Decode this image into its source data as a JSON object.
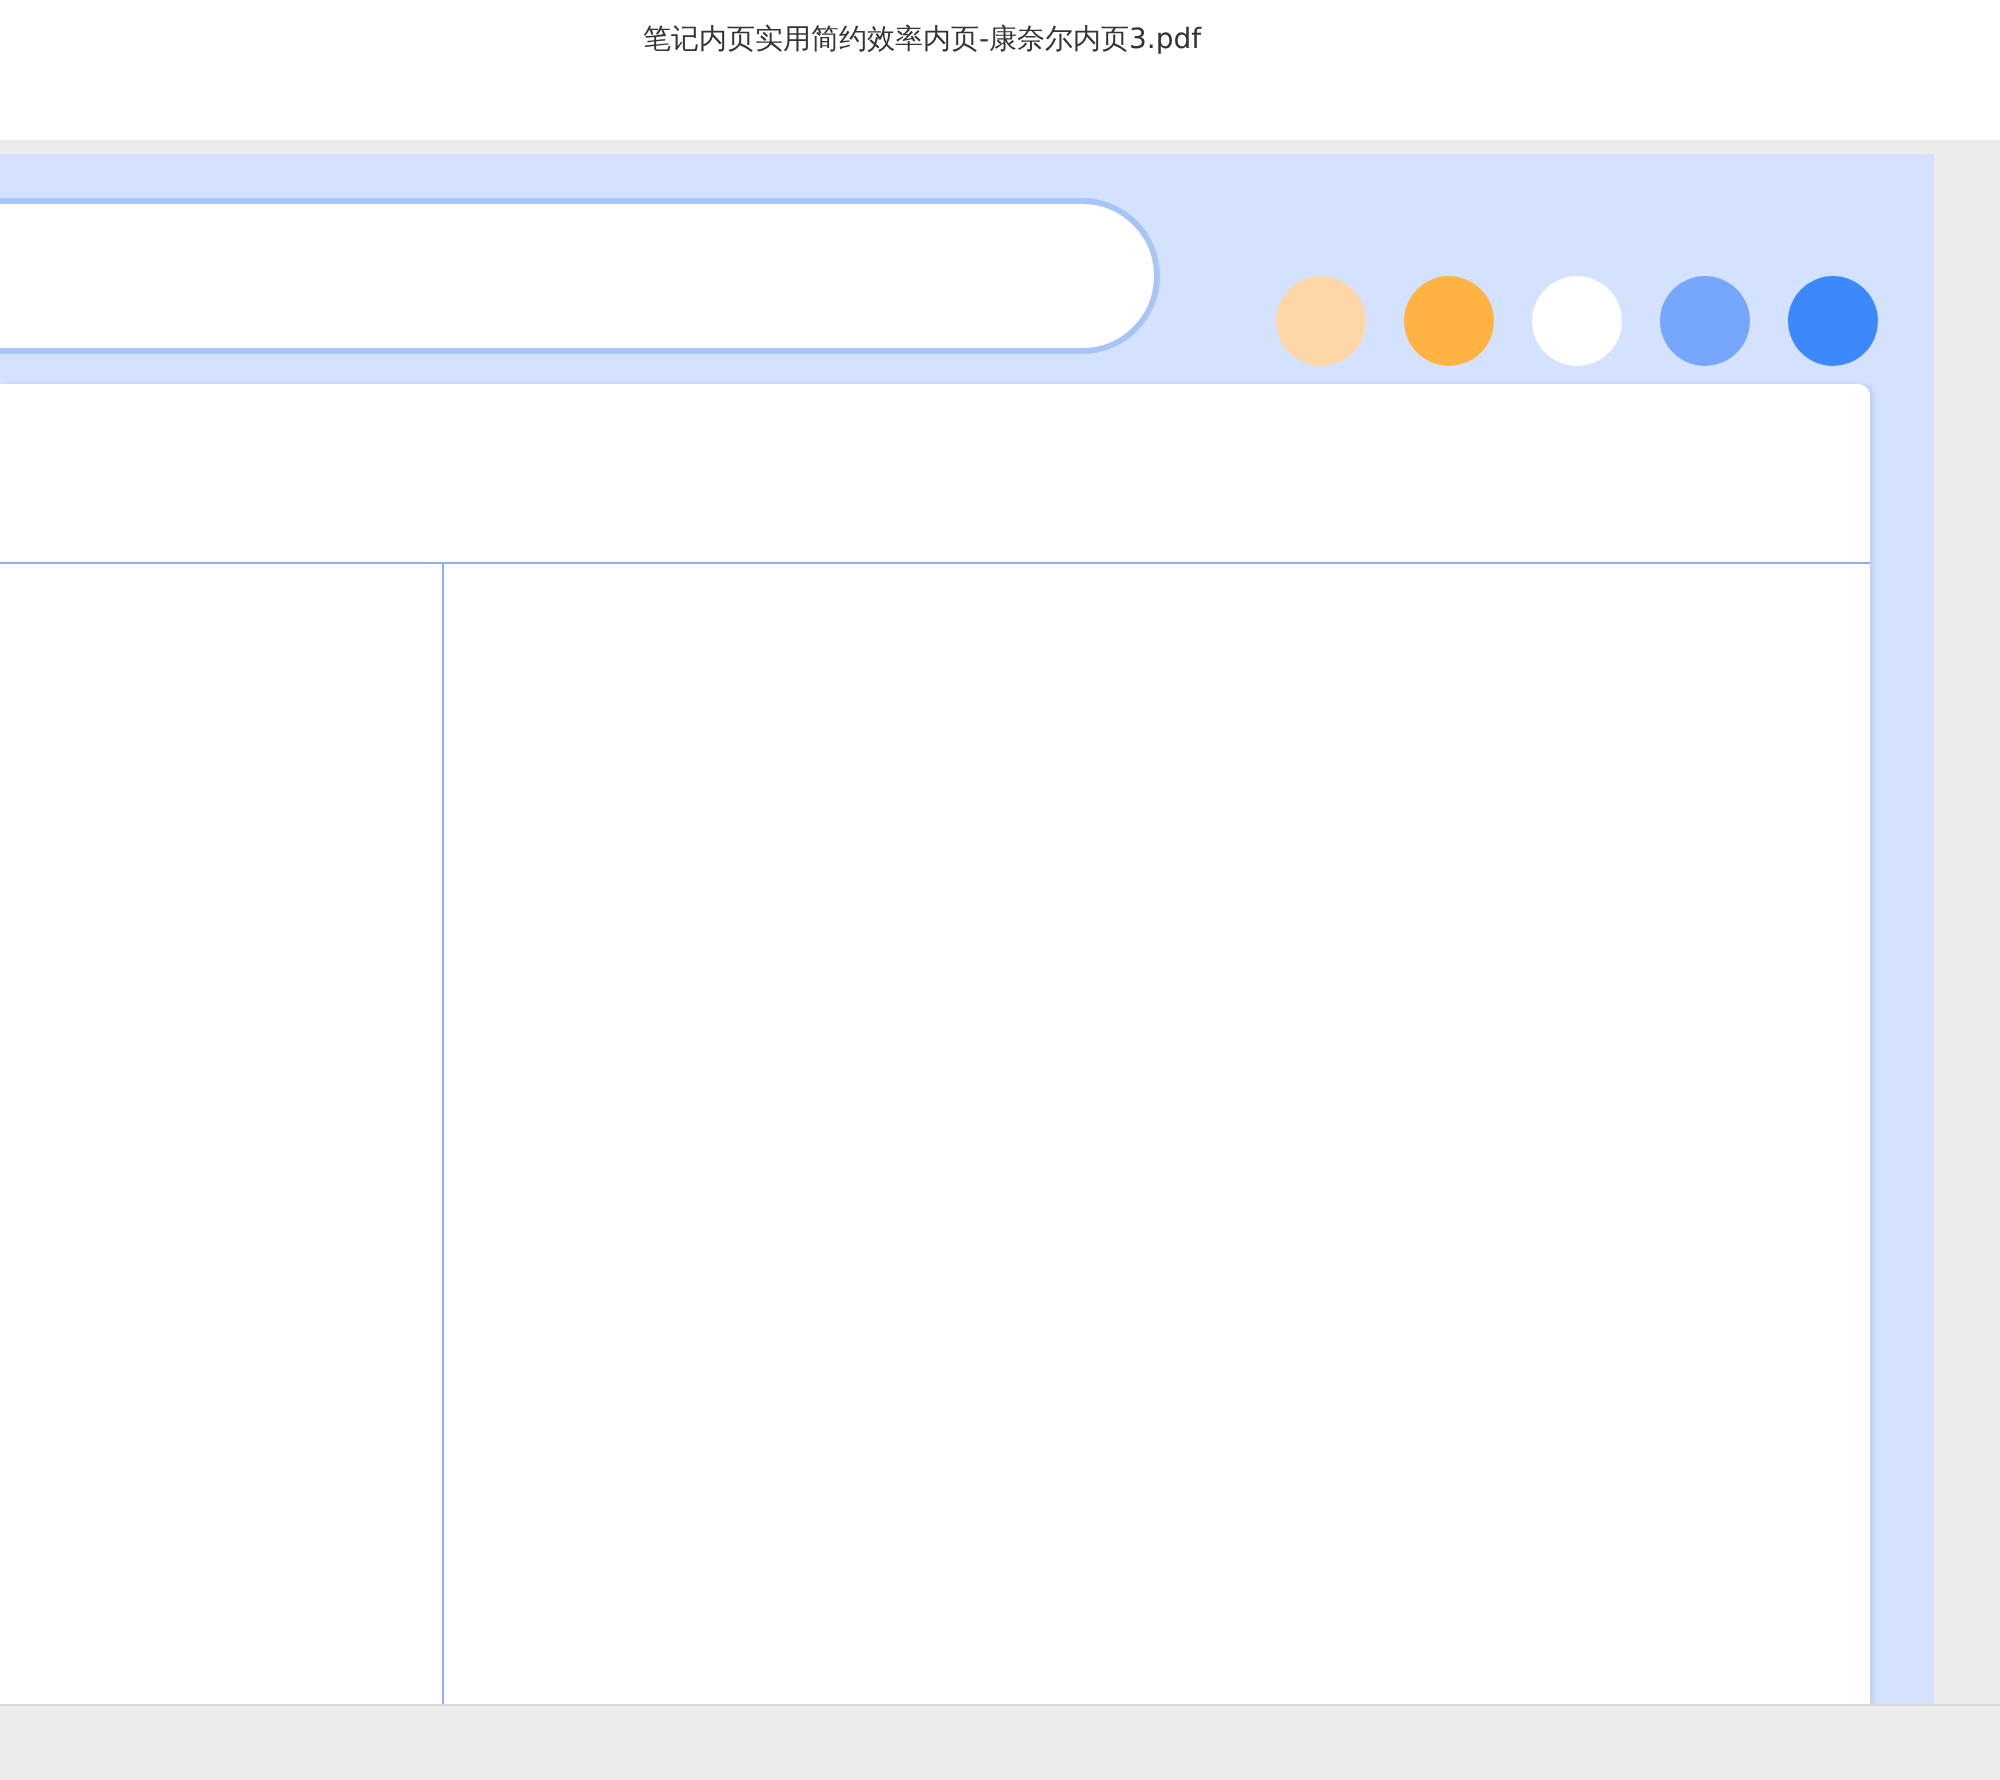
{
  "window": {
    "title": "笔记内页实用简约效率内页-康奈尔内页3.pdf"
  },
  "page": {
    "color_dots": [
      {
        "color": "#fdd7a8"
      },
      {
        "color": "#ffb342"
      },
      {
        "color": "#ffffff"
      },
      {
        "color": "#76a7fd"
      },
      {
        "color": "#3b89fa"
      }
    ]
  }
}
